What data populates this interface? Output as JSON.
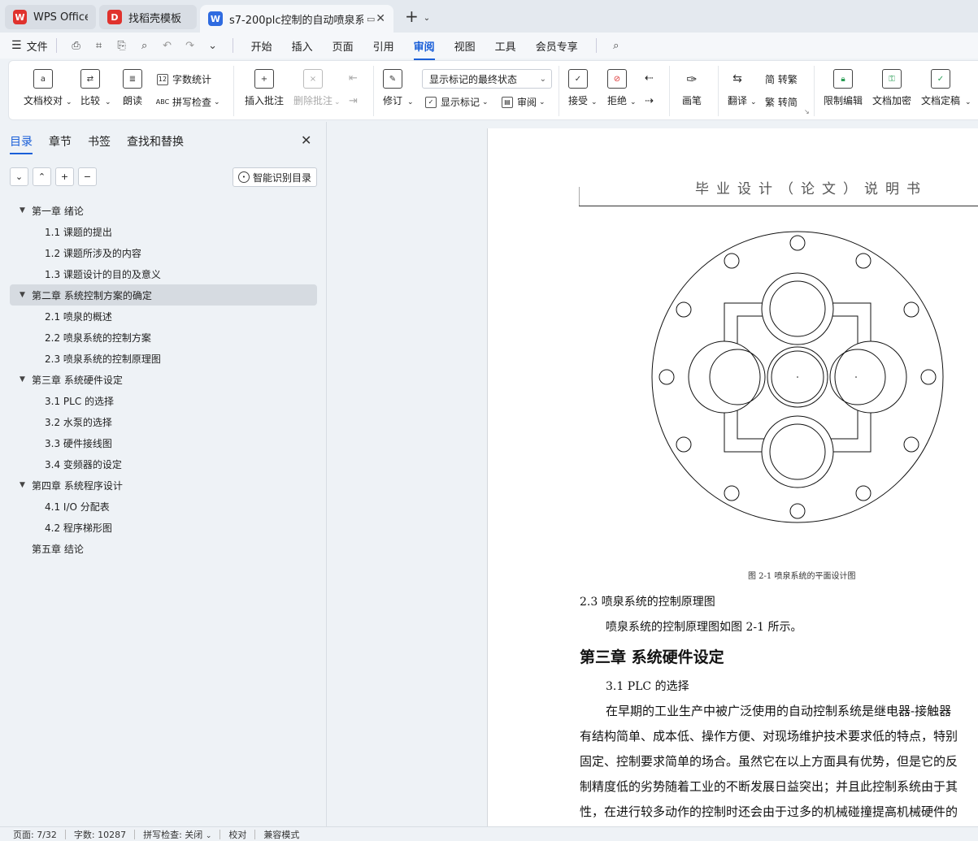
{
  "tabs": [
    {
      "label": "WPS Office",
      "logo": "W",
      "color": "#e0322d"
    },
    {
      "label": "找稻壳模板",
      "logo": "D",
      "color": "#e0322d"
    },
    {
      "label": "s7-200plc控制的自动喷泉系统",
      "logo": "W",
      "color": "#2f6be0"
    }
  ],
  "menu": {
    "file": "文件",
    "items": [
      "开始",
      "插入",
      "页面",
      "引用",
      "审阅",
      "视图",
      "工具",
      "会员专享"
    ]
  },
  "ribbon": {
    "doc_check": "文档校对",
    "compare": "比较",
    "read_aloud": "朗读",
    "word_count": "字数统计",
    "spell_check": "拼写检查",
    "insert_comment": "插入批注",
    "delete_comment": "删除批注",
    "revise": "修订",
    "markup_state": "显示标记的最终状态",
    "show_markup": "显示标记",
    "review": "审阅",
    "accept": "接受",
    "reject": "拒绝",
    "pen": "画笔",
    "translate": "翻译",
    "to_trad": "简 转繁",
    "to_simp": "繁 转简",
    "restrict_edit": "限制编辑",
    "doc_encrypt": "文档加密",
    "doc_finalize": "文档定稿"
  },
  "sidebar": {
    "tabs": [
      "目录",
      "章节",
      "书签",
      "查找和替换"
    ],
    "smart_toc": "智能识别目录",
    "toc": [
      {
        "level": 1,
        "label": "第一章  绪论",
        "expanded": true
      },
      {
        "level": 2,
        "label": "1.1 课题的提出"
      },
      {
        "level": 2,
        "label": "1.2  课题所涉及的内容"
      },
      {
        "level": 2,
        "label": "1.3  课题设计的目的及意义"
      },
      {
        "level": 1,
        "label": "第二章  系统控制方案的确定",
        "expanded": true,
        "selected": true
      },
      {
        "level": 2,
        "label": "2.1  喷泉的概述"
      },
      {
        "level": 2,
        "label": "2.2  喷泉系统的控制方案"
      },
      {
        "level": 2,
        "label": "2.3  喷泉系统的控制原理图"
      },
      {
        "level": 1,
        "label": "第三章  系统硬件设定",
        "expanded": true
      },
      {
        "level": 2,
        "label": "3.1 PLC 的选择"
      },
      {
        "level": 2,
        "label": "3.2 水泵的选择"
      },
      {
        "level": 2,
        "label": "3.3  硬件接线图"
      },
      {
        "level": 2,
        "label": "3.4  变频器的设定"
      },
      {
        "level": 1,
        "label": "第四章  系统程序设计",
        "expanded": true
      },
      {
        "level": 2,
        "label": "4.1 I/O 分配表"
      },
      {
        "level": 2,
        "label": "4.2 程序梯形图"
      },
      {
        "level": 1,
        "label": "第五章  结论",
        "expanded": false
      }
    ]
  },
  "document": {
    "header": "毕业设计（论文）说明书",
    "caption": "图 2-1  喷泉系统的平面设计图",
    "section": "2.3  喷泉系统的控制原理图",
    "para1": "喷泉系统的控制原理图如图 2-1 所示。",
    "chapter": "第三章  系统硬件设定",
    "sub": "3.1 PLC 的选择",
    "lines": [
      "在早期的工业生产中被广泛使用的自动控制系统是继电器-接触器",
      "有结构简单、成本低、操作方便、对现场维护技术要求低的特点，特别",
      "固定、控制要求简单的场合。虽然它在以上方面具有优势，但是它的反",
      "制精度低的劣势随着工业的不断发展日益突出；并且此控制系统由于其",
      "性，在进行较多动作的控制时还会由于过多的机械碰撞提高机械硬件的"
    ]
  },
  "status": {
    "page": "页面: 7/32",
    "words": "字数: 10287",
    "spell": "拼写检查: 关闭",
    "proof": "校对",
    "compat": "兼容模式"
  }
}
